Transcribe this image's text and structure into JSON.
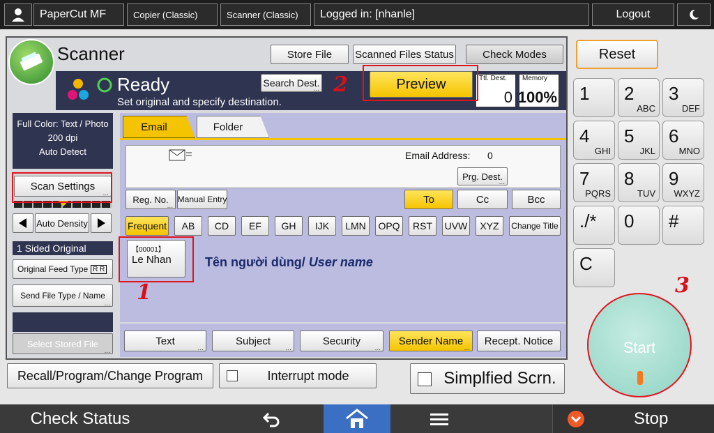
{
  "topbar": {
    "app": "PaperCut MF",
    "copier": "Copier (Classic)",
    "scanner": "Scanner (Classic)",
    "logged_in": "Logged in: [nhanle]",
    "logout": "Logout"
  },
  "header": {
    "title": "Scanner",
    "store_file": "Store File",
    "scanned_status": "Scanned Files Status",
    "check_modes": "Check Modes"
  },
  "status": {
    "ready": "Ready",
    "message": "Set original and specify destination.",
    "search_dest": "Search Dest.",
    "preview": "Preview",
    "ttl_dest_label": "Ttl. Dest.",
    "ttl_dest_value": "0",
    "memory_label": "Memory",
    "memory_value": "100%"
  },
  "left": {
    "mode_line1": "Full Color: Text / Photo",
    "mode_line2": "200 dpi",
    "mode_line3": "Auto Detect",
    "scan_settings": "Scan Settings",
    "auto_density": "Auto Density",
    "sided": "1 Sided Original",
    "feed_type": "Original Feed Type",
    "send_file_type": "Send File Type / Name",
    "select_stored": "Select Stored File"
  },
  "tabs": {
    "email": "Email",
    "folder": "Folder"
  },
  "dest": {
    "email_address_label": "Email Address:",
    "email_address_count": "0",
    "prg_dest": "Prg. Dest.",
    "reg_no": "Reg. No.",
    "manual_entry": "Manual Entry",
    "to": "To",
    "cc": "Cc",
    "bcc": "Bcc"
  },
  "index_tabs": [
    "Frequent",
    "AB",
    "CD",
    "EF",
    "GH",
    "IJK",
    "LMN",
    "OPQ",
    "RST",
    "UVW",
    "XYZ",
    "Change Title"
  ],
  "entry": {
    "id": "【00001】",
    "name": "Le Nhan"
  },
  "annotation": {
    "user_name_vi": "Tên người dùng/ ",
    "user_name_en": "User name"
  },
  "bottom_tabs": [
    "Text",
    "Subject",
    "Security",
    "Sender Name",
    "Recept. Notice"
  ],
  "footer": {
    "recall": "Recall/Program/Change Program",
    "interrupt": "Interrupt mode",
    "simplified": "Simplfied Scrn."
  },
  "keypad": {
    "reset": "Reset",
    "keys": [
      {
        "main": "1",
        "sub": ""
      },
      {
        "main": "2",
        "sub": "ABC"
      },
      {
        "main": "3",
        "sub": "DEF"
      },
      {
        "main": "4",
        "sub": "GHI"
      },
      {
        "main": "5",
        "sub": "JKL"
      },
      {
        "main": "6",
        "sub": "MNO"
      },
      {
        "main": "7",
        "sub": "PQRS"
      },
      {
        "main": "8",
        "sub": "TUV"
      },
      {
        "main": "9",
        "sub": "WXYZ"
      },
      {
        "main": "./*",
        "sub": ""
      },
      {
        "main": "0",
        "sub": ""
      },
      {
        "main": "#",
        "sub": ""
      }
    ],
    "clear": "C",
    "start": "Start"
  },
  "steps": [
    "1",
    "2",
    "3"
  ],
  "bottombar": {
    "check_status": "Check Status",
    "stop": "Stop"
  },
  "colors": {
    "accent_yellow": "#f5c400",
    "annotation_red": "#e0141e",
    "start_teal": "#9fd9cd",
    "home_blue": "#3a6fc4"
  }
}
